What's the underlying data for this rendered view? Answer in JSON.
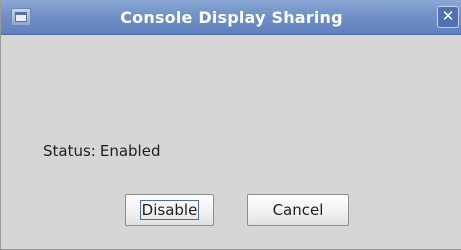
{
  "window": {
    "title": "Console Display Sharing",
    "close_glyph": "✕",
    "icon": "app-window-icon"
  },
  "status": {
    "label": "Status:",
    "value": "Enabled"
  },
  "buttons": {
    "disable_label": "Disable",
    "cancel_label": "Cancel"
  },
  "colors": {
    "titlebar": "#6f8fc6",
    "dialog_background": "#d6d6d6",
    "text": "#1e1e1e"
  }
}
